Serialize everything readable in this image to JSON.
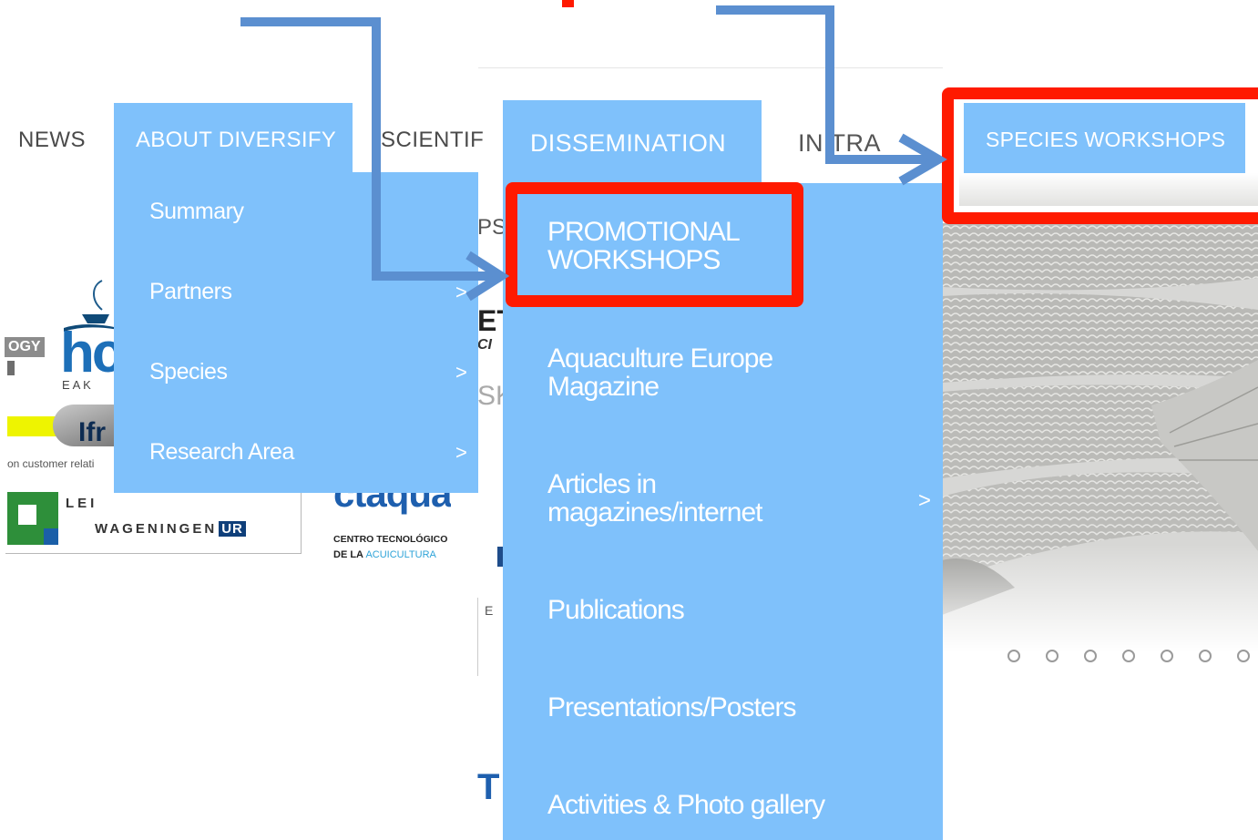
{
  "nav": {
    "news": "NEWS",
    "about": "ABOUT DIVERSIFY",
    "scientific": "SCIENTIF",
    "dissemination": "DISSEMINATION",
    "intra": "IN  TRA",
    "species_workshops": "SPECIES WORKSHOPS"
  },
  "about_menu": {
    "items": [
      {
        "label": "Summary"
      },
      {
        "label": "Partners",
        "chevron": ">"
      },
      {
        "label": "Species",
        "chevron": ">"
      },
      {
        "label": "Research Area",
        "chevron": ">"
      }
    ]
  },
  "dissemination_menu": {
    "items": [
      {
        "line1": "PROMOTIONAL",
        "line2": "WORKSHOPS"
      },
      {
        "line1": "Aquaculture Europe",
        "line2": "Magazine"
      },
      {
        "line1": "Articles in",
        "line2": "magazines/internet",
        "chevron": ">"
      },
      {
        "line1": "Publications"
      },
      {
        "line1": "Presentations/Posters"
      },
      {
        "line1": "Activities & Photo gallery"
      }
    ]
  },
  "background": {
    "logo_ogy": "OGY",
    "logo_hc": "hc",
    "logo_eak": "E  A  K",
    "logo_ifr": "Ifr",
    "customer_text": "on customer relati",
    "lei": "LEI",
    "wageningen": "WAGENINGEN",
    "wageningen_ur": "UR",
    "ctaqua": "ctaqua",
    "ctaqua_sub1": "CENTRO TECNOLÓGICO",
    "ctaqua_sub2_a": "DE LA",
    "ctaqua_sub2_b": "ACUICULTURA",
    "frag_ps": "PS",
    "frag_et": "ET",
    "frag_ci": "CI",
    "frag_sk": "SK",
    "frag_t": "T",
    "frag_e": "E"
  },
  "carousel": {
    "dot_count": 7
  },
  "colors": {
    "menu_blue": "#7fc1fb",
    "highlight_red": "#ff1a00",
    "arrow_blue": "#5b8fd0"
  }
}
